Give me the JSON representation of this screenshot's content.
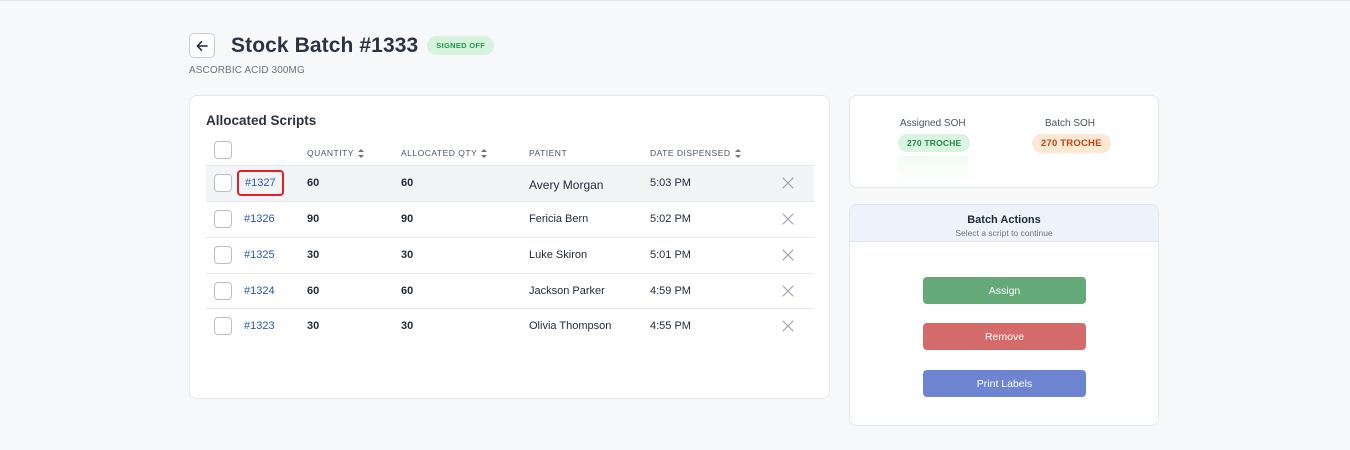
{
  "header": {
    "title": "Stock Batch #1333",
    "status": "SIGNED OFF",
    "subtitle": "ASCORBIC ACID 300MG"
  },
  "scripts": {
    "title": "Allocated Scripts",
    "columns": [
      "QUANTITY",
      "ALLOCATED QTY",
      "PATIENT",
      "DATE DISPENSED"
    ],
    "rows": [
      {
        "id": "#1327",
        "quantity": "60",
        "allocated": "60",
        "patient": "Avery Morgan",
        "date": "5:03 PM"
      },
      {
        "id": "#1326",
        "quantity": "90",
        "allocated": "90",
        "patient": "Fericia Bern",
        "date": "5:02 PM"
      },
      {
        "id": "#1325",
        "quantity": "30",
        "allocated": "30",
        "patient": "Luke Skiron",
        "date": "5:01 PM"
      },
      {
        "id": "#1324",
        "quantity": "60",
        "allocated": "60",
        "patient": "Jackson Parker",
        "date": "4:59 PM"
      },
      {
        "id": "#1323",
        "quantity": "30",
        "allocated": "30",
        "patient": "Olivia Thompson",
        "date": "4:55 PM"
      }
    ]
  },
  "soh": {
    "assigned_label": "Assigned SOH",
    "assigned_value": "270 TROCHE",
    "batch_label": "Batch SOH",
    "batch_value": "270 TROCHE"
  },
  "actions": {
    "title": "Batch Actions",
    "subtitle": "Select a script to continue",
    "assign_label": "Assign",
    "remove_label": "Remove",
    "print_label": "Print Labels"
  },
  "colors": {
    "assign": "#63aa78",
    "remove": "#d46a6a",
    "print": "#6d84d1",
    "link": "#2b55b0",
    "highlight_border": "#e01e2c"
  }
}
